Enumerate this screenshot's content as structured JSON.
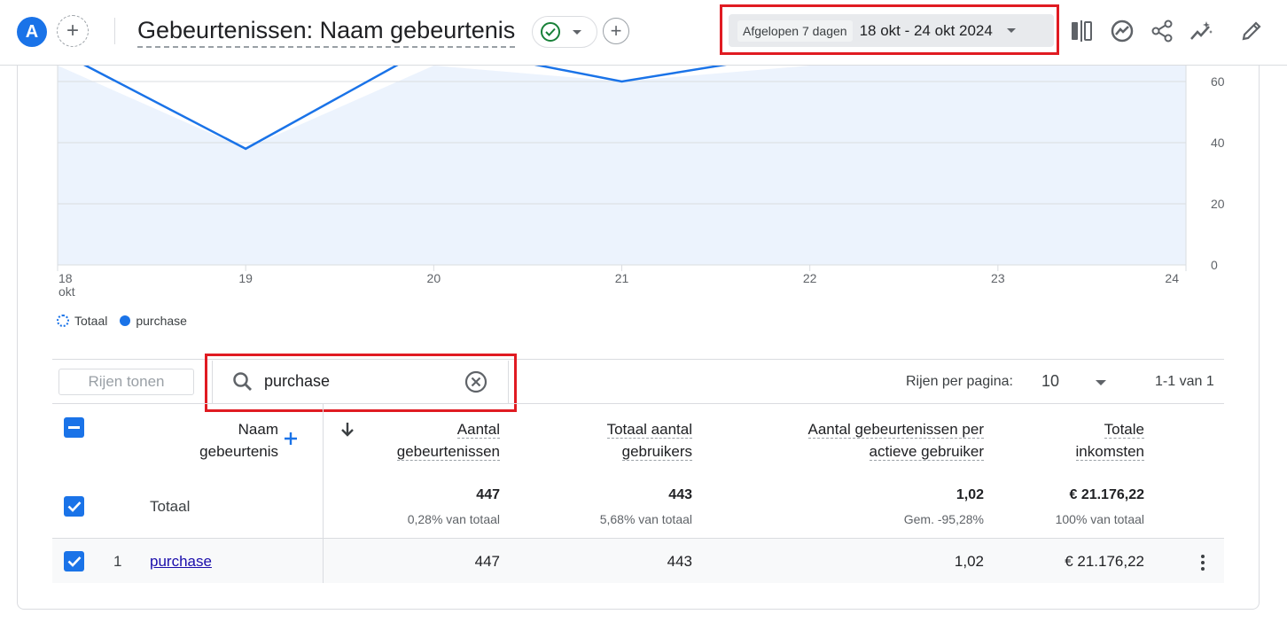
{
  "header": {
    "avatar_letter": "A",
    "title": "Gebeurtenissen: Naam gebeurtenis",
    "date_preset": "Afgelopen 7 dagen",
    "date_range": "18 okt - 24 okt 2024",
    "tools": [
      "compare-icon",
      "insights-icon",
      "share-icon",
      "sparkle-icon",
      "edit-icon"
    ]
  },
  "chart_data": {
    "type": "line",
    "x": [
      "18",
      "19",
      "20",
      "21",
      "22",
      "23",
      "24"
    ],
    "x_sublabel_first": "okt",
    "y_ticks": [
      "0",
      "20",
      "40",
      "60"
    ],
    "series": [
      {
        "name": "Totaal",
        "values": [
          70,
          38,
          72,
          60,
          70,
          80,
          80
        ]
      },
      {
        "name": "purchase",
        "values": [
          70,
          38,
          72,
          60,
          70,
          80,
          80
        ]
      }
    ]
  },
  "legend": {
    "total": "Totaal",
    "purchase": "purchase"
  },
  "toolbar": {
    "show_rows": "Rijen tonen",
    "search_value": "purchase",
    "rows_per_page_label": "Rijen per pagina:",
    "rows_per_page_value": "10",
    "page_info": "1-1 van 1"
  },
  "table": {
    "col_name_l1": "Naam",
    "col_name_l2": "gebeurtenis",
    "col1_l1": "Aantal",
    "col1_l2": "gebeurtenissen",
    "col2_l1": "Totaal aantal",
    "col2_l2": "gebruikers",
    "col3_l1": "Aantal gebeurtenissen per",
    "col3_l2": "actieve gebruiker",
    "col4_l1": "Totale",
    "col4_l2": "inkomsten",
    "total_label": "Totaal",
    "total": {
      "c1": "447",
      "c1_sub": "0,28% van totaal",
      "c2": "443",
      "c2_sub": "5,68% van totaal",
      "c3": "1,02",
      "c3_sub": "Gem. -95,28%",
      "c4": "€ 21.176,22",
      "c4_sub": "100% van totaal"
    },
    "rows": [
      {
        "index": "1",
        "name": "purchase",
        "c1": "447",
        "c2": "443",
        "c3": "1,02",
        "c4": "€ 21.176,22"
      }
    ]
  },
  "highlight_color": "#e01b22",
  "accent_color": "#1a73e8"
}
